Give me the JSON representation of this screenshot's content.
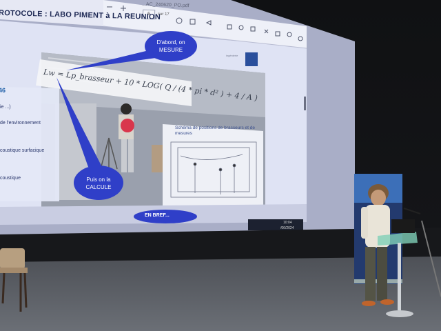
{
  "pdf_viewer": {
    "tab_label": "...AC_240620_PO.pdf",
    "page_input": "6",
    "page_total": "sur 17"
  },
  "slide": {
    "title": "ROTOCOLE : LABO PIMENT à LA REUNION",
    "section_number": "46",
    "left_texts": [
      "ie ...)",
      "de l'environnement",
      "coustique surfacique",
      "coustique"
    ],
    "bubble_mesure": "D'abord, on MESURE",
    "bubble_calcule": "Puis on la CALCULE",
    "formula": "Lw = Lp_brasseur + 10 * LOG( Q / (4 * pi * d² ) + 4 / A )",
    "schema_title": "Schéma de positions de brasseurs et de mesures",
    "footer_button": "EN BREF..."
  },
  "taskbar": {
    "time": "10:04",
    "date": "/06/2024"
  },
  "colors": {
    "slide_bg": "#dfe3f4",
    "bubble": "#2f3fc8",
    "title_blue": "#1f2a55",
    "banner_blue": "#233a6e"
  }
}
